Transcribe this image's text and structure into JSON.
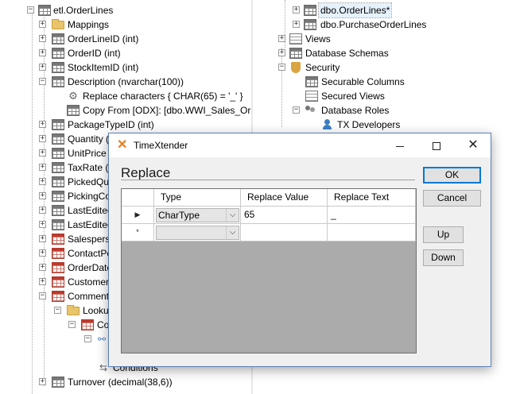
{
  "left_tree": {
    "items": [
      {
        "label": "etl.OrderLines",
        "icon": "table-icon"
      },
      {
        "label": "Mappings",
        "icon": "folder-icon"
      },
      {
        "label": "OrderLineID (int)",
        "icon": "field-key-icon"
      },
      {
        "label": "OrderID (int)",
        "icon": "field-icon"
      },
      {
        "label": "StockItemID (int)",
        "icon": "field-icon"
      },
      {
        "label": "Description (nvarchar(100))",
        "icon": "field-icon"
      },
      {
        "label": "Replace characters { CHAR(65) = '_' }",
        "icon": "transformation-icon"
      },
      {
        "label": "Copy From [ODX]: [dbo.WWI_Sales_OrderL",
        "icon": "copy-from-icon"
      },
      {
        "label": "PackageTypeID (int)",
        "icon": "field-icon"
      },
      {
        "label": "Quantity (int",
        "icon": "field-icon"
      },
      {
        "label": "UnitPrice (d",
        "icon": "field-icon"
      },
      {
        "label": "TaxRate (d",
        "icon": "field-icon"
      },
      {
        "label": "PickedQua",
        "icon": "field-icon"
      },
      {
        "label": "PickingCom",
        "icon": "field-icon"
      },
      {
        "label": "LastEdited",
        "icon": "field-icon"
      },
      {
        "label": "LastEditedT",
        "icon": "field-icon"
      },
      {
        "label": "Salesperso",
        "icon": "lookup-field-icon"
      },
      {
        "label": "ContactPer",
        "icon": "lookup-field-icon"
      },
      {
        "label": "OrderDate",
        "icon": "lookup-field-icon"
      },
      {
        "label": "CustomerID",
        "icon": "lookup-field-icon"
      },
      {
        "label": "Comments",
        "icon": "lookup-field-icon"
      },
      {
        "label": "Lookup",
        "icon": "folder-icon"
      },
      {
        "label": "Co",
        "icon": "lookup-table-icon"
      },
      {
        "label": "",
        "icon": "relation-icon"
      },
      {
        "label": "Conditions",
        "icon": "conditions-icon"
      },
      {
        "label": "Turnover (decimal(38,6))",
        "icon": "field-icon"
      }
    ]
  },
  "right_tree": {
    "items": [
      {
        "label": "dbo.OrderLines*",
        "icon": "table-icon",
        "selected": true
      },
      {
        "label": "dbo.PurchaseOrderLines",
        "icon": "table-icon"
      },
      {
        "label": "Views",
        "icon": "views-icon"
      },
      {
        "label": "Database Schemas",
        "icon": "table-icon"
      },
      {
        "label": "Security",
        "icon": "shield-icon"
      },
      {
        "label": "Securable Columns",
        "icon": "securable-columns-icon"
      },
      {
        "label": "Secured Views",
        "icon": "secured-views-icon"
      },
      {
        "label": "Database Roles",
        "icon": "roles-icon"
      },
      {
        "label": "TX Developers",
        "icon": "person-icon"
      }
    ]
  },
  "dialog": {
    "title": "TimeXtender",
    "heading": "Replace",
    "buttons": {
      "ok": "OK",
      "cancel": "Cancel",
      "up": "Up",
      "down": "Down"
    },
    "grid": {
      "columns": [
        "Type",
        "Replace Value",
        "Replace Text"
      ],
      "rows": [
        {
          "marker": "▶",
          "type": "CharType",
          "replace_value": "65",
          "replace_text": "_"
        },
        {
          "marker": "*",
          "type": "",
          "replace_value": "",
          "replace_text": ""
        }
      ]
    }
  }
}
